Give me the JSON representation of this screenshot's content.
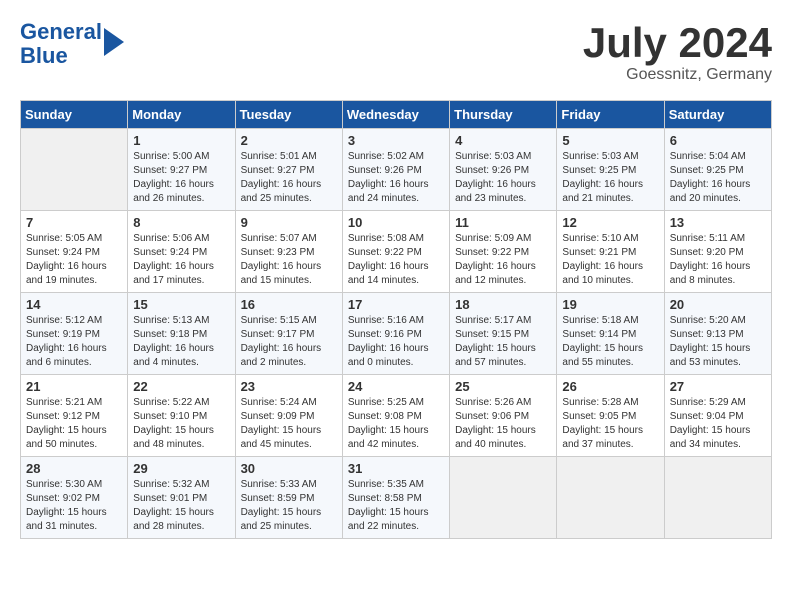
{
  "logo": {
    "line1": "General",
    "line2": "Blue"
  },
  "title": "July 2024",
  "location": "Goessnitz, Germany",
  "days_header": [
    "Sunday",
    "Monday",
    "Tuesday",
    "Wednesday",
    "Thursday",
    "Friday",
    "Saturday"
  ],
  "weeks": [
    [
      {
        "day": "",
        "sunrise": "",
        "sunset": "",
        "daylight": ""
      },
      {
        "day": "1",
        "sunrise": "Sunrise: 5:00 AM",
        "sunset": "Sunset: 9:27 PM",
        "daylight": "Daylight: 16 hours and 26 minutes."
      },
      {
        "day": "2",
        "sunrise": "Sunrise: 5:01 AM",
        "sunset": "Sunset: 9:27 PM",
        "daylight": "Daylight: 16 hours and 25 minutes."
      },
      {
        "day": "3",
        "sunrise": "Sunrise: 5:02 AM",
        "sunset": "Sunset: 9:26 PM",
        "daylight": "Daylight: 16 hours and 24 minutes."
      },
      {
        "day": "4",
        "sunrise": "Sunrise: 5:03 AM",
        "sunset": "Sunset: 9:26 PM",
        "daylight": "Daylight: 16 hours and 23 minutes."
      },
      {
        "day": "5",
        "sunrise": "Sunrise: 5:03 AM",
        "sunset": "Sunset: 9:25 PM",
        "daylight": "Daylight: 16 hours and 21 minutes."
      },
      {
        "day": "6",
        "sunrise": "Sunrise: 5:04 AM",
        "sunset": "Sunset: 9:25 PM",
        "daylight": "Daylight: 16 hours and 20 minutes."
      }
    ],
    [
      {
        "day": "7",
        "sunrise": "Sunrise: 5:05 AM",
        "sunset": "Sunset: 9:24 PM",
        "daylight": "Daylight: 16 hours and 19 minutes."
      },
      {
        "day": "8",
        "sunrise": "Sunrise: 5:06 AM",
        "sunset": "Sunset: 9:24 PM",
        "daylight": "Daylight: 16 hours and 17 minutes."
      },
      {
        "day": "9",
        "sunrise": "Sunrise: 5:07 AM",
        "sunset": "Sunset: 9:23 PM",
        "daylight": "Daylight: 16 hours and 15 minutes."
      },
      {
        "day": "10",
        "sunrise": "Sunrise: 5:08 AM",
        "sunset": "Sunset: 9:22 PM",
        "daylight": "Daylight: 16 hours and 14 minutes."
      },
      {
        "day": "11",
        "sunrise": "Sunrise: 5:09 AM",
        "sunset": "Sunset: 9:22 PM",
        "daylight": "Daylight: 16 hours and 12 minutes."
      },
      {
        "day": "12",
        "sunrise": "Sunrise: 5:10 AM",
        "sunset": "Sunset: 9:21 PM",
        "daylight": "Daylight: 16 hours and 10 minutes."
      },
      {
        "day": "13",
        "sunrise": "Sunrise: 5:11 AM",
        "sunset": "Sunset: 9:20 PM",
        "daylight": "Daylight: 16 hours and 8 minutes."
      }
    ],
    [
      {
        "day": "14",
        "sunrise": "Sunrise: 5:12 AM",
        "sunset": "Sunset: 9:19 PM",
        "daylight": "Daylight: 16 hours and 6 minutes."
      },
      {
        "day": "15",
        "sunrise": "Sunrise: 5:13 AM",
        "sunset": "Sunset: 9:18 PM",
        "daylight": "Daylight: 16 hours and 4 minutes."
      },
      {
        "day": "16",
        "sunrise": "Sunrise: 5:15 AM",
        "sunset": "Sunset: 9:17 PM",
        "daylight": "Daylight: 16 hours and 2 minutes."
      },
      {
        "day": "17",
        "sunrise": "Sunrise: 5:16 AM",
        "sunset": "Sunset: 9:16 PM",
        "daylight": "Daylight: 16 hours and 0 minutes."
      },
      {
        "day": "18",
        "sunrise": "Sunrise: 5:17 AM",
        "sunset": "Sunset: 9:15 PM",
        "daylight": "Daylight: 15 hours and 57 minutes."
      },
      {
        "day": "19",
        "sunrise": "Sunrise: 5:18 AM",
        "sunset": "Sunset: 9:14 PM",
        "daylight": "Daylight: 15 hours and 55 minutes."
      },
      {
        "day": "20",
        "sunrise": "Sunrise: 5:20 AM",
        "sunset": "Sunset: 9:13 PM",
        "daylight": "Daylight: 15 hours and 53 minutes."
      }
    ],
    [
      {
        "day": "21",
        "sunrise": "Sunrise: 5:21 AM",
        "sunset": "Sunset: 9:12 PM",
        "daylight": "Daylight: 15 hours and 50 minutes."
      },
      {
        "day": "22",
        "sunrise": "Sunrise: 5:22 AM",
        "sunset": "Sunset: 9:10 PM",
        "daylight": "Daylight: 15 hours and 48 minutes."
      },
      {
        "day": "23",
        "sunrise": "Sunrise: 5:24 AM",
        "sunset": "Sunset: 9:09 PM",
        "daylight": "Daylight: 15 hours and 45 minutes."
      },
      {
        "day": "24",
        "sunrise": "Sunrise: 5:25 AM",
        "sunset": "Sunset: 9:08 PM",
        "daylight": "Daylight: 15 hours and 42 minutes."
      },
      {
        "day": "25",
        "sunrise": "Sunrise: 5:26 AM",
        "sunset": "Sunset: 9:06 PM",
        "daylight": "Daylight: 15 hours and 40 minutes."
      },
      {
        "day": "26",
        "sunrise": "Sunrise: 5:28 AM",
        "sunset": "Sunset: 9:05 PM",
        "daylight": "Daylight: 15 hours and 37 minutes."
      },
      {
        "day": "27",
        "sunrise": "Sunrise: 5:29 AM",
        "sunset": "Sunset: 9:04 PM",
        "daylight": "Daylight: 15 hours and 34 minutes."
      }
    ],
    [
      {
        "day": "28",
        "sunrise": "Sunrise: 5:30 AM",
        "sunset": "Sunset: 9:02 PM",
        "daylight": "Daylight: 15 hours and 31 minutes."
      },
      {
        "day": "29",
        "sunrise": "Sunrise: 5:32 AM",
        "sunset": "Sunset: 9:01 PM",
        "daylight": "Daylight: 15 hours and 28 minutes."
      },
      {
        "day": "30",
        "sunrise": "Sunrise: 5:33 AM",
        "sunset": "Sunset: 8:59 PM",
        "daylight": "Daylight: 15 hours and 25 minutes."
      },
      {
        "day": "31",
        "sunrise": "Sunrise: 5:35 AM",
        "sunset": "Sunset: 8:58 PM",
        "daylight": "Daylight: 15 hours and 22 minutes."
      },
      {
        "day": "",
        "sunrise": "",
        "sunset": "",
        "daylight": ""
      },
      {
        "day": "",
        "sunrise": "",
        "sunset": "",
        "daylight": ""
      },
      {
        "day": "",
        "sunrise": "",
        "sunset": "",
        "daylight": ""
      }
    ]
  ]
}
